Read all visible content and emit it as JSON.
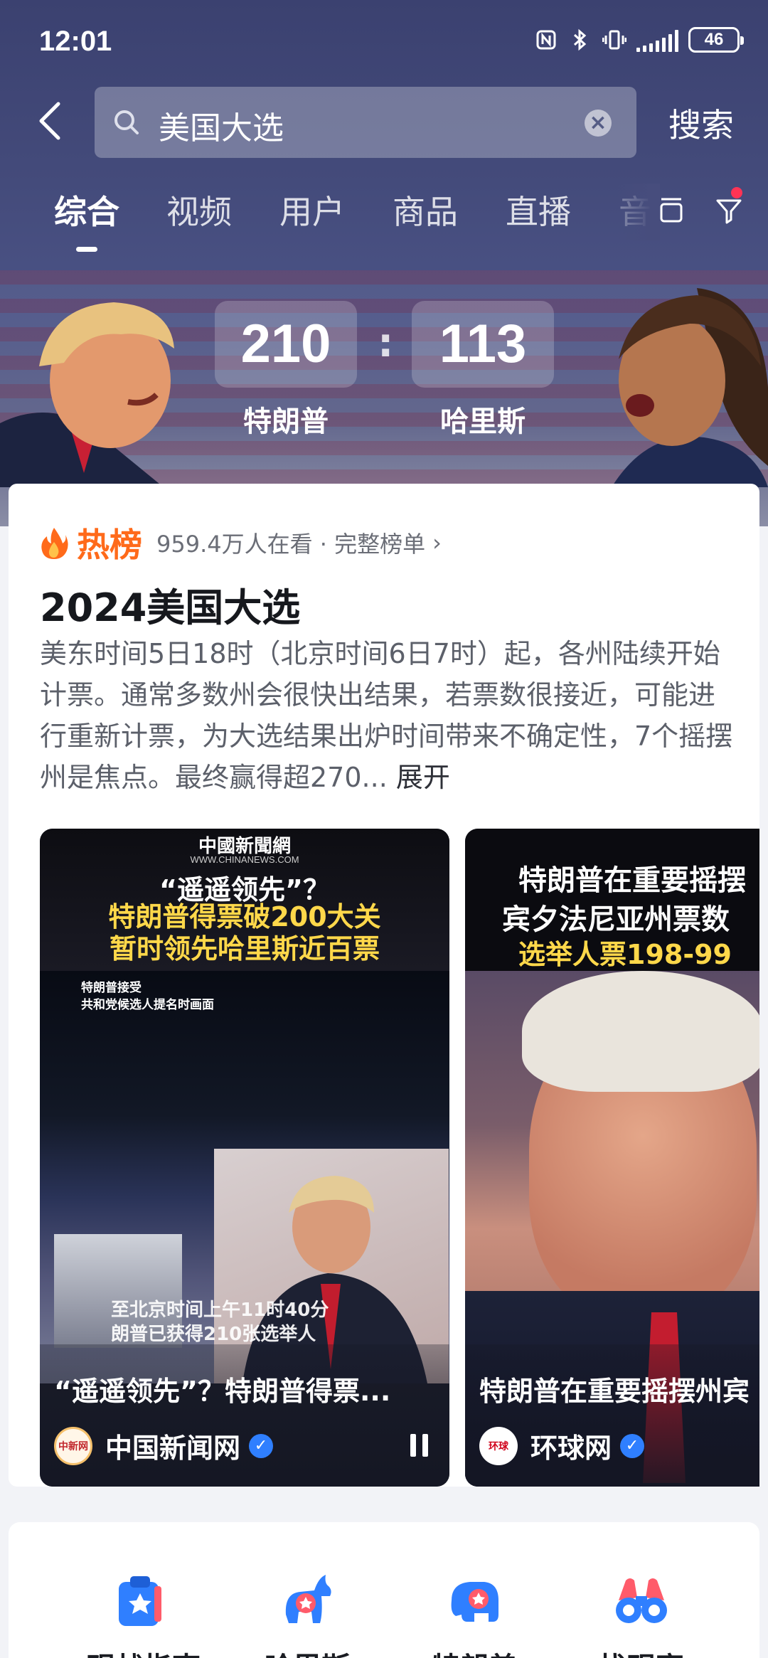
{
  "status_bar": {
    "time": "12:01",
    "battery": "46"
  },
  "search": {
    "query": "美国大选",
    "button": "搜索"
  },
  "tabs": [
    {
      "label": "综合",
      "active": true
    },
    {
      "label": "视频"
    },
    {
      "label": "用户"
    },
    {
      "label": "商品"
    },
    {
      "label": "直播"
    },
    {
      "label": "音"
    }
  ],
  "score": {
    "left_value": "210",
    "left_name": "特朗普",
    "right_value": "113",
    "right_name": "哈里斯",
    "separator": ":"
  },
  "hot": {
    "badge": "热榜",
    "meta": "959.4万人在看 · 完整榜单",
    "title": "2024美国大选",
    "description": "美东时间5日18时（北京时间6日7时）起，各州陆续开始计票。通常多数州会很快出结果，若票数很接近，可能进行重新计票，为大选结果出炉时间带来不确定性，7个摇摆州是焦点。最终赢得超270...",
    "expand": "展开"
  },
  "videos": [
    {
      "brand": "中國新聞網",
      "brand_sub": "WWW.CHINANEWS.COM",
      "headline1": "“遥遥领先”？",
      "headline2": "特朗普得票破200大关",
      "headline3": "暂时领先哈里斯近百票",
      "small": "特朗普接受\n共和党候选人提名时画面",
      "caption": "至北京时间上午11时40分\n朗普已获得210张选举人",
      "title": "“遥遥领先”？特朗普得票...",
      "source": "中国新闻网",
      "logo_text": "中新网"
    },
    {
      "headline1": "特朗普在重要摇摆",
      "headline2": "宾夕法尼亚州票数",
      "headline3": "选举人票198-99",
      "title": "特朗普在重要摇摆州宾",
      "source": "环球网",
      "logo_text": "环球"
    }
  ],
  "shortcuts": [
    {
      "label": "观战指南",
      "icon": "clipboard-star-icon"
    },
    {
      "label": "哈里斯",
      "icon": "donkey-icon"
    },
    {
      "label": "特朗普",
      "icon": "elephant-icon"
    },
    {
      "label": "找观察",
      "icon": "binoculars-icon"
    }
  ],
  "colors": {
    "accent_orange": "#ff6a1a",
    "header_bg": "#444b7b",
    "verified_blue": "#2f7fff",
    "headline_yellow": "#ffd84a",
    "icon_blue": "#2f7fff"
  }
}
